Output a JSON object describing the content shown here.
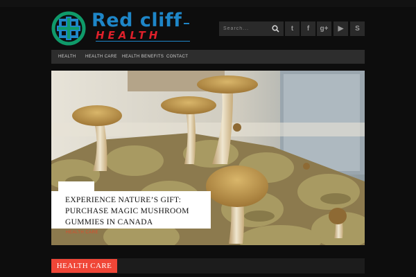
{
  "logo": {
    "title": "Red cliff",
    "subtitle": "HEALTH"
  },
  "search": {
    "placeholder": "Search...",
    "icon": "search-icon"
  },
  "social": [
    {
      "name": "twitter-icon",
      "glyph": "t"
    },
    {
      "name": "facebook-icon",
      "glyph": "f"
    },
    {
      "name": "google-plus-icon",
      "glyph": "g+"
    },
    {
      "name": "youtube-icon",
      "glyph": "▶"
    },
    {
      "name": "skype-icon",
      "glyph": "S"
    }
  ],
  "nav": {
    "items": [
      "HEALTH",
      "HEALTH CARE",
      "HEALTH BENEFITS",
      "CONTACT"
    ]
  },
  "featured": {
    "title": "EXPERIENCE NATURE’S GIFT: PURCHASE MAGIC MUSHROOM GUMMIES IN CANADA",
    "category": "HEALTH CARE"
  },
  "section": {
    "label": "HEALTH CARE"
  },
  "colors": {
    "background": "#0d0d0d",
    "nav": "#2d2d2d",
    "accent": "#f04637",
    "logo_blue": "#1e86c8",
    "logo_red": "#e0202a",
    "logo_green": "#0f9a6a"
  }
}
